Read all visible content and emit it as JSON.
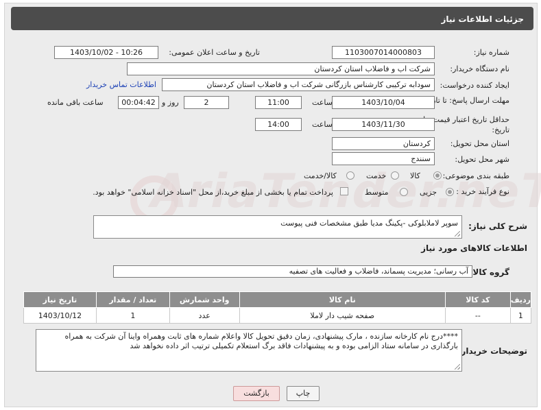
{
  "header": {
    "title": "جزئیات اطلاعات نیاز"
  },
  "labels": {
    "need_number": "شماره نیاز:",
    "announce_datetime": "تاریخ و ساعت اعلان عمومی:",
    "buyer_org": "نام دستگاه خریدار:",
    "requester": "ایجاد کننده درخواست:",
    "deadline": "مهلت ارسال پاسخ: تا تاریخ:",
    "min_price_validity": "حداقل تاریخ اعتبار قیمت: تا تاریخ:",
    "time": "ساعت",
    "day_and": "روز و",
    "remaining": "ساعت باقی مانده",
    "province": "استان محل تحویل:",
    "city": "شهر محل تحویل:",
    "category": "طبقه بندی موضوعی:",
    "purchase_type": "نوع فرآیند خرید :",
    "need_summary": "شرح کلی نیاز:",
    "goods_info": "اطلاعات کالاهای مورد نیاز",
    "goods_group": "گروه کالا:",
    "buyer_notes": "توضیحات خریدار:"
  },
  "values": {
    "need_number": "1103007014000803",
    "announce_datetime": "1403/10/02 - 10:26",
    "buyer_org": "شرکت اب و فاضلاب استان کردستان",
    "requester": "سودابه ترکیبی کارشناس بازرگانی شرکت اب و فاضلاب استان کردستان",
    "buyer_contact_link": "اطلاعات تماس خریدار",
    "deadline_date": "1403/10/04",
    "deadline_time": "11:00",
    "days": "2",
    "remaining_time": "00:04:42",
    "validity_date": "1403/11/30",
    "validity_time": "14:00",
    "province": "کردستان",
    "city": "سنندج",
    "need_summary": "سوپر لاملابلوکی -پکینگ مدیا طبق مشخصات فنی پیوست",
    "goods_group": "آب رسانی؛ مدیریت پسماند، فاضلاب و فعالیت های تصفیه",
    "buyer_notes": "****درج نام کارخانه سازنده ، مارک پیشنهادی، زمان دقیق تحویل کالا واعلام شماره های ثابت وهمراه واینا آن شرکت به همراه بارگذاری در سامانه ستاد الزامی بوده و به پیشنهادات فاقد برگ استعلام تکمیلی ترتیب اثر داده نخواهد شد"
  },
  "category_options": [
    {
      "label": "کالا",
      "selected": true
    },
    {
      "label": "خدمت",
      "selected": false
    },
    {
      "label": "کالا/خدمت",
      "selected": false
    }
  ],
  "purchase_options": [
    {
      "label": "جزیی",
      "selected": true
    },
    {
      "label": "متوسط",
      "selected": false
    }
  ],
  "treasury_note": "پرداخت تمام یا بخشی از مبلغ خرید،از محل \"اسناد خزانه اسلامی\" خواهد بود.",
  "table": {
    "headers": [
      "ردیف",
      "کد کالا",
      "نام کالا",
      "واحد شمارش",
      "تعداد / مقدار",
      "تاریخ نیاز"
    ],
    "rows": [
      [
        "1",
        "--",
        "صفحه شیب دار لاملا",
        "عدد",
        "1",
        "1403/10/12"
      ]
    ]
  },
  "buttons": {
    "print": "چاپ",
    "back": "بازگشت"
  },
  "watermark": "AriaTender.neT"
}
